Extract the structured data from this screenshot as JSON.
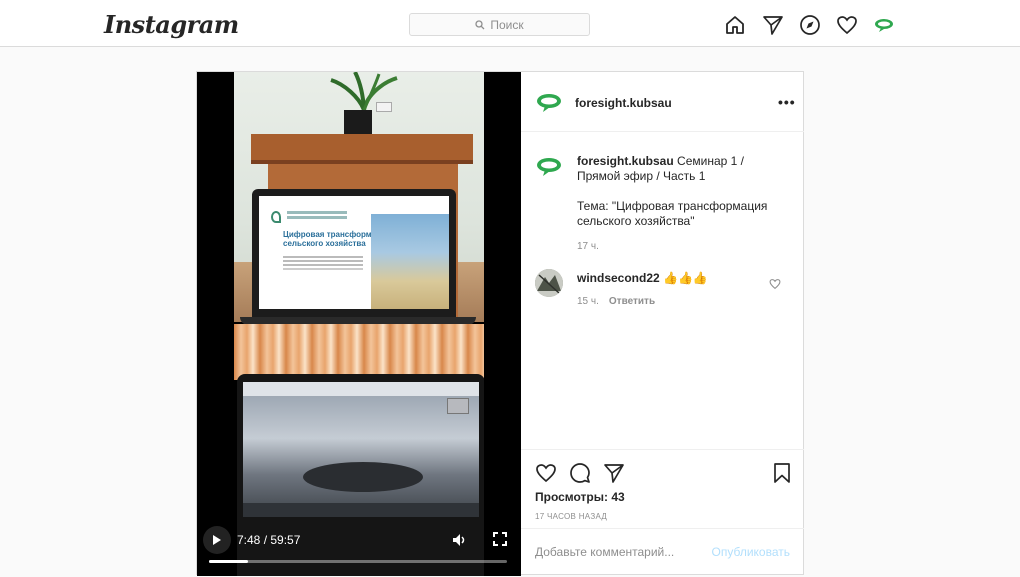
{
  "header": {
    "logo": "Instagram",
    "search_placeholder": "Поиск"
  },
  "post": {
    "author": "foresight.kubsau",
    "caption_user": "foresight.kubsau",
    "caption_line1": "Семинар 1 / Прямой эфир / Часть 1",
    "caption_line2": "Тема: \"Цифровая трансформация сельского хозяйства\"",
    "caption_time": "17 ч.",
    "comment": {
      "user": "windsecond22",
      "emoji": "👍👍👍",
      "time": "15 ч.",
      "reply_label": "Ответить"
    },
    "views_label": "Просмотры: 43",
    "posted_ago": "17 ЧАСОВ НАЗАД",
    "add_comment_placeholder": "Добавьте комментарий...",
    "publish_label": "Опубликовать"
  },
  "video": {
    "time": "7:48 / 59:57",
    "progress": 0.13,
    "slide_title": "Цифровая трансформация сельского хозяйства"
  },
  "colors": {
    "brand_green": "#2fa84f",
    "link_blue_disabled": "#b2dffc"
  }
}
